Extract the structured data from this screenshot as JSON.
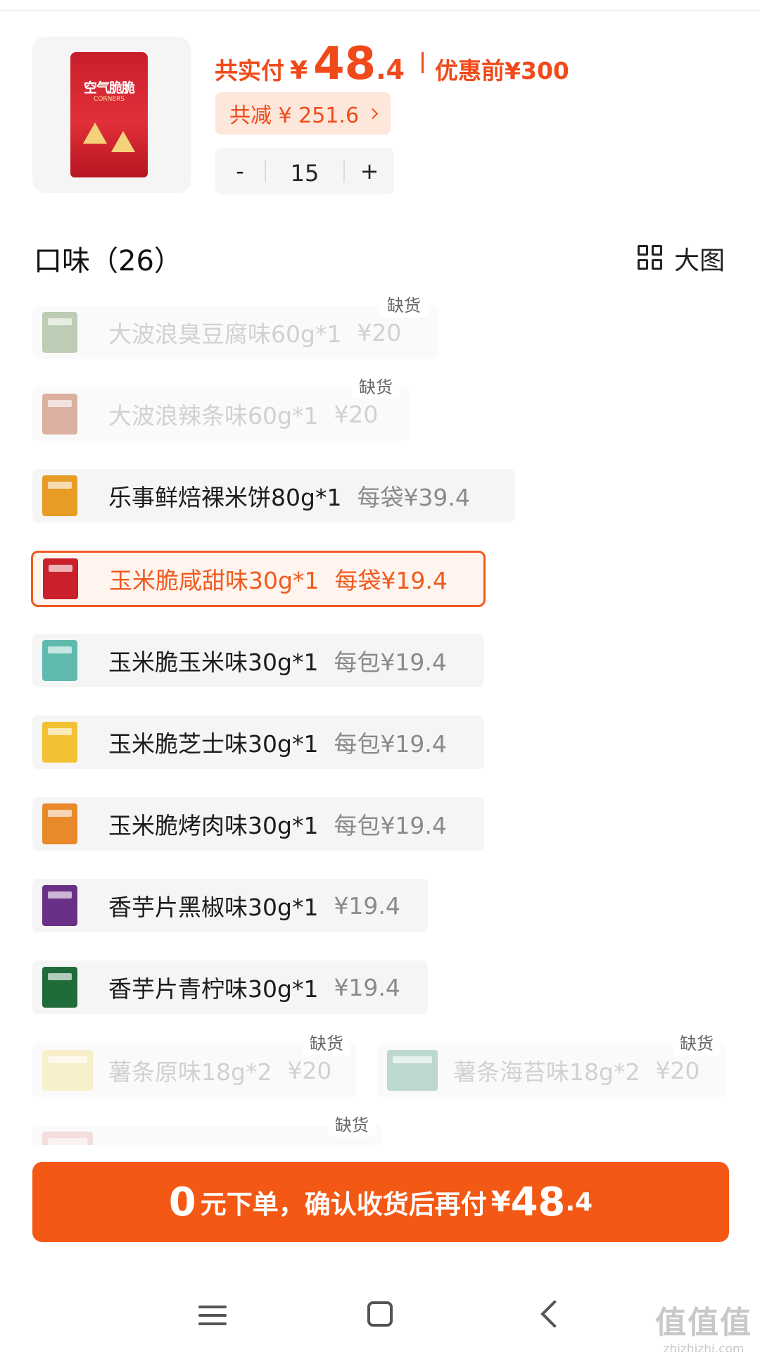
{
  "product": {
    "bag_text": "空气脆脆",
    "bag_subtext": "CORNERS",
    "paid_label": "共实付",
    "currency": "¥",
    "paid_int": "48",
    "paid_dec": ".4",
    "before_discount": "优惠前¥300",
    "discount_text": "共减 ¥ 251.6",
    "quantity": "15",
    "minus_label": "-",
    "plus_label": "+"
  },
  "flavors": {
    "title": "口味（26）",
    "view_label": "大图",
    "out_of_stock_label": "缺货",
    "options": [
      {
        "name": "大波浪臭豆腐味60g*1",
        "price": "¥20",
        "out": true,
        "thumb": "#6f8f5a"
      },
      {
        "name": "大波浪辣条味60g*1",
        "price": "¥20",
        "out": true,
        "thumb": "#b0522f"
      },
      {
        "name": "乐事鲜焙裸米饼80g*1",
        "price": "每袋¥39.4",
        "out": false,
        "thumb": "#e79c25"
      },
      {
        "name": "玉米脆咸甜味30g*1",
        "price": "每袋¥19.4",
        "out": false,
        "selected": true,
        "thumb": "#c9202c"
      },
      {
        "name": "玉米脆玉米味30g*1",
        "price": "每包¥19.4",
        "out": false,
        "thumb": "#5fb9ad"
      },
      {
        "name": "玉米脆芝士味30g*1",
        "price": "每包¥19.4",
        "out": false,
        "thumb": "#f2c234"
      },
      {
        "name": "玉米脆烤肉味30g*1",
        "price": "每包¥19.4",
        "out": false,
        "thumb": "#e88a2c"
      },
      {
        "name": "香芋片黑椒味30g*1",
        "price": "¥19.4",
        "out": false,
        "thumb": "#6a2f86"
      },
      {
        "name": "香芋片青柠味30g*1",
        "price": "¥19.4",
        "out": false,
        "thumb": "#1f6b3a"
      },
      {
        "name": "薯条原味18g*2",
        "price": "¥20",
        "out": true,
        "thumb": "#f1dd8e"
      },
      {
        "name": "薯条海苔味18g*2",
        "price": "¥20",
        "out": true,
        "thumb": "#6cab97"
      }
    ]
  },
  "cta": {
    "zero": "0",
    "text": "元下单，确认收货后再付",
    "yen": "¥",
    "int": "48",
    "dec": ".4"
  },
  "watermark": {
    "big": "值值值",
    "small": "zhizhizhi.com"
  },
  "colors": {
    "accent": "#f05a1e",
    "cta": "#f35814",
    "chip_bg": "#f5f5f5"
  }
}
